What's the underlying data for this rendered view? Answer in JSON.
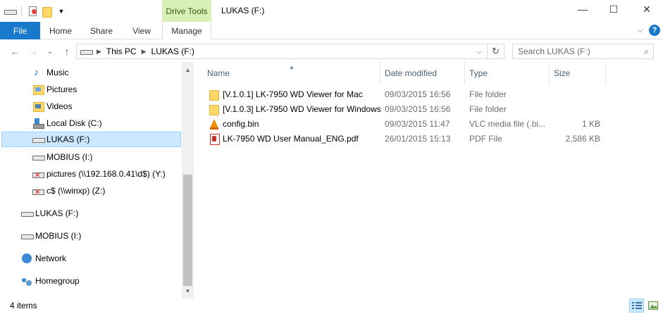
{
  "window": {
    "contextual_tab": "Drive Tools",
    "title": "LUKAS (F:)",
    "minimize": "—",
    "maximize": "☐",
    "close": "✕"
  },
  "ribbon": {
    "tabs": [
      "File",
      "Home",
      "Share",
      "View",
      "Manage"
    ],
    "collapse": "⌵",
    "help": "?"
  },
  "address": {
    "back": "←",
    "forward": "→",
    "recent": "⌄",
    "up": "↑",
    "crumbs": [
      "This PC",
      "LUKAS (F:)"
    ],
    "dropdown": "⌵",
    "refresh": "↻",
    "search_placeholder": "Search LUKAS (F:)",
    "search_icon": "⌕"
  },
  "nav": {
    "items": [
      {
        "label": "Music",
        "icon": "music-icon"
      },
      {
        "label": "Pictures",
        "icon": "pictures-icon"
      },
      {
        "label": "Videos",
        "icon": "videos-icon"
      },
      {
        "label": "Local Disk (C:)",
        "icon": "local-disk-icon"
      },
      {
        "label": "LUKAS (F:)",
        "icon": "drive-icon",
        "selected": true
      },
      {
        "label": "MOBIUS (I:)",
        "icon": "drive-icon"
      },
      {
        "label": "pictures (\\\\192.168.0.41\\d$) (Y:)",
        "icon": "disconnected-network-drive-icon"
      },
      {
        "label": "c$ (\\\\winxp) (Z:)",
        "icon": "disconnected-network-drive-icon"
      }
    ],
    "roots": [
      {
        "label": "LUKAS (F:)",
        "icon": "drive-icon"
      },
      {
        "label": "MOBIUS (I:)",
        "icon": "drive-icon"
      },
      {
        "label": "Network",
        "icon": "network-icon"
      },
      {
        "label": "Homegroup",
        "icon": "homegroup-icon"
      }
    ],
    "scroll_up": "▲",
    "scroll_down": "▼"
  },
  "files": {
    "columns": [
      "Name",
      "Date modified",
      "Type",
      "Size"
    ],
    "sort_indicator": "▲",
    "rows": [
      {
        "name": "[V.1.0.1] LK-7950 WD Viewer for Mac",
        "date": "09/03/2015 16:56",
        "type": "File folder",
        "size": "",
        "icon": "folder-icon"
      },
      {
        "name": "[V.1.0.3] LK-7950 WD Viewer for Windows",
        "date": "09/03/2015 16:56",
        "type": "File folder",
        "size": "",
        "icon": "folder-icon"
      },
      {
        "name": "config.bin",
        "date": "09/03/2015 11:47",
        "type": "VLC media file (.bi...",
        "size": "1 KB",
        "icon": "vlc-icon"
      },
      {
        "name": "LK-7950 WD User Manual_ENG.pdf",
        "date": "26/01/2015 15:13",
        "type": "PDF File",
        "size": "2,586 KB",
        "icon": "pdf-icon"
      }
    ]
  },
  "status": {
    "item_count": "4 items"
  },
  "colors": {
    "accent": "#1979ca",
    "selection": "#cce8ff",
    "selection_border": "#99d1ff",
    "contextual_tab": "#d8f0b8"
  }
}
